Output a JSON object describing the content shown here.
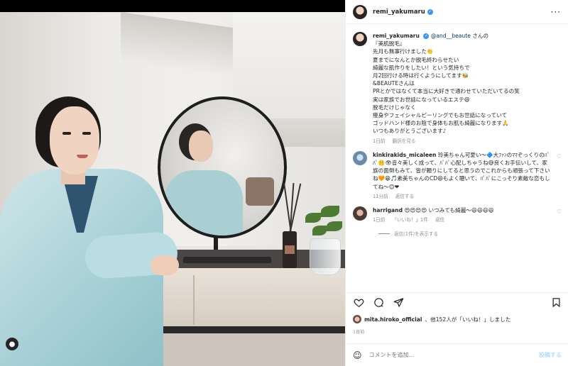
{
  "post": {
    "username": "remi_yakumaru",
    "more_label": "···"
  },
  "caption": {
    "username": "remi_yakumaru",
    "mention": "@and__beaute",
    "mention_suffix": " さんの",
    "lines": [
      "『美肌脱毛』",
      "先月も無事行けました👏",
      "",
      "夏までになんとか脱毛終わらせたい",
      "綺麗な肌作りをしたい！という気持ちで",
      "月2回行ける時は行くようにしてます🐝",
      "",
      "&BEAUTEさんは",
      "PRとかではなくて本当に大好きで通わせていただいてるの笑",
      "実は家族でお世話になっているエステ😄",
      "脱毛だけじゃなく",
      "痩身やフェイシャルピーリングでもお世話になっていて",
      "ゴッドハンド様のお陰で身体もお肌も綺麗になります🙏",
      "",
      "いつもありがとうございます♪"
    ],
    "time": "1日前",
    "translate": "翻訳を見る"
  },
  "comments": [
    {
      "username": "kinkirakids_micaleen",
      "text": "玲美ちゃん可愛い〜🔷大ﾌｧﾝのﾏﾏぞっくりのﾊﾟﾊﾟ🤫👁音々美しく成って、ﾊﾟﾊﾟ心配しちゃうね😅良くお手伝いして、家族の面倒もみて、皆が頼りにしてると思うのでこれからも頑張って下さいね🧡😁🎵素美ちゃんのCD😆もよく聴いて、ﾊﾟﾊﾟにこっそり素敵な恋もしてね〜😊❤",
      "time": "11分前",
      "reply": "返信する"
    },
    {
      "username": "harrigand",
      "text": "😍😍😍😍 いつみても綺麗〜😃😃😃😃",
      "time": "1日前",
      "likes": "「いいね！」1件",
      "reply": "返信",
      "view_replies": "返信(1件)を表示する"
    }
  ],
  "likes": {
    "user": "mita.hiroko_official",
    "text": "、他152人が「いいね！」しました"
  },
  "date": "1日前",
  "add_comment": {
    "placeholder": "コメントを追加...",
    "post_label": "投稿する"
  },
  "colors": {
    "verified": "#3897f0",
    "mention": "#00376b",
    "muted": "#8e8e8e"
  },
  "icons": [
    "heart-icon",
    "comment-icon",
    "share-icon",
    "bookmark-icon",
    "emoji-icon",
    "more-icon",
    "verified-icon",
    "user-tag-icon"
  ]
}
